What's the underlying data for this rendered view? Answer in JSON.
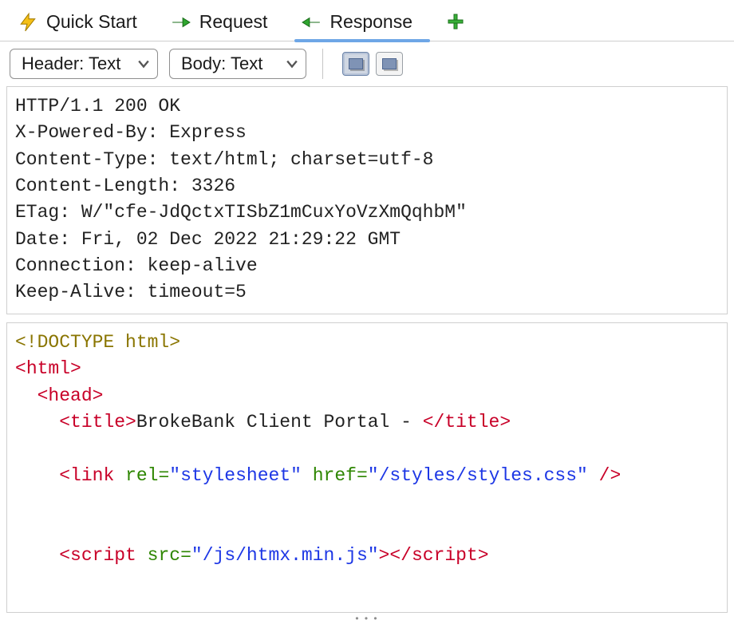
{
  "tabs": {
    "quick_start": "Quick Start",
    "request": "Request",
    "response": "Response"
  },
  "toolbar": {
    "header_dropdown": "Header: Text",
    "body_dropdown": "Body: Text"
  },
  "headers": {
    "status_line": "HTTP/1.1 200 OK",
    "x_powered_by": "X-Powered-By: Express",
    "content_type": "Content-Type: text/html; charset=utf-8",
    "content_length": "Content-Length: 3326",
    "etag": "ETag: W/\"cfe-JdQctxTISbZ1mCuxYoVzXmQqhbM\"",
    "date": "Date: Fri, 02 Dec 2022 21:29:22 GMT",
    "connection": "Connection: keep-alive",
    "keep_alive": "Keep-Alive: timeout=5"
  },
  "body": {
    "doctype": "<!DOCTYPE html>",
    "html_open": "html",
    "head_open": "head",
    "title_tag": "title",
    "title_text": "BrokeBank Client Portal - ",
    "link_tag": "link",
    "link_rel_attr": "rel",
    "link_rel_val": "\"stylesheet\"",
    "link_href_attr": "href",
    "link_href_val": "\"/styles/styles.css\"",
    "script_tag": "script",
    "script_src_attr": "src",
    "script_src_val": "\"/js/htmx.min.js\""
  }
}
